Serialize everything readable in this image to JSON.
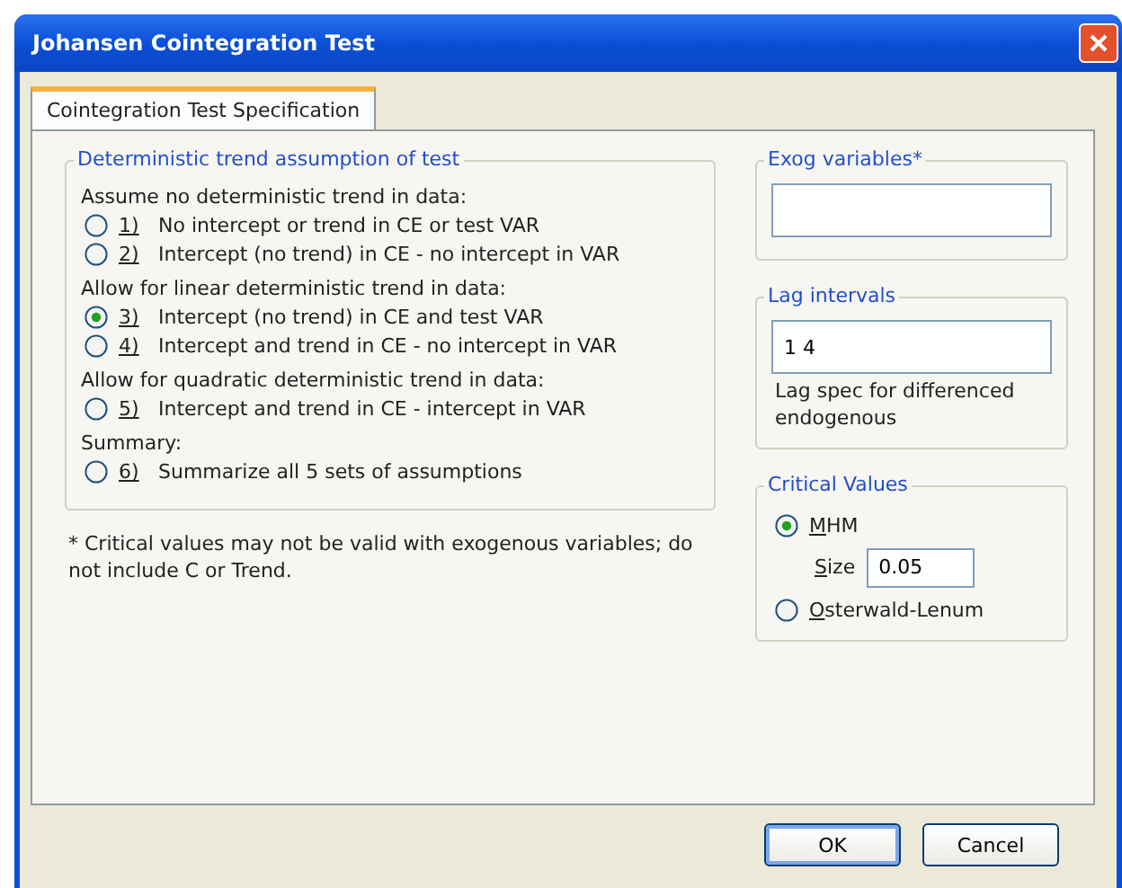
{
  "window": {
    "title": "Johansen Cointegration Test"
  },
  "tabs": [
    {
      "label": "Cointegration Test Specification",
      "selected": true
    }
  ],
  "trend_group": {
    "title": "Deterministic trend assumption of test",
    "sections": [
      {
        "heading": "Assume no deterministic trend in data:",
        "options": [
          {
            "key": "1)",
            "label": "No intercept or trend in CE or test VAR",
            "selected": false
          },
          {
            "key": "2)",
            "label": "Intercept (no trend) in CE - no intercept in VAR",
            "selected": false
          }
        ]
      },
      {
        "heading": "Allow for linear deterministic trend in data:",
        "options": [
          {
            "key": "3)",
            "label": "Intercept (no trend) in CE and test VAR",
            "selected": true
          },
          {
            "key": "4)",
            "label": "Intercept and trend in CE - no intercept in VAR",
            "selected": false
          }
        ]
      },
      {
        "heading": "Allow for quadratic deterministic trend in data:",
        "options": [
          {
            "key": "5)",
            "label": "Intercept and trend in CE - intercept in VAR",
            "selected": false
          }
        ]
      },
      {
        "heading": "Summary:",
        "options": [
          {
            "key": "6)",
            "label": "Summarize all 5 sets of assumptions",
            "selected": false
          }
        ]
      }
    ]
  },
  "footnote": "* Critical values may not be valid with exogenous variables; do not include C or Trend.",
  "exog_group": {
    "title": "Exog variables*"
  },
  "lag_group": {
    "title": "Lag intervals",
    "value": "1 4",
    "note": "Lag spec for differenced endogenous"
  },
  "critical_group": {
    "title": "Critical Values",
    "options": [
      {
        "label": "MHM",
        "selected": true
      },
      {
        "label": "Osterwald-Lenum",
        "selected": false
      }
    ],
    "size_label": "Size",
    "size_value": "0.05"
  },
  "buttons": [
    {
      "label": "OK",
      "default": true
    },
    {
      "label": "Cancel",
      "default": false
    }
  ]
}
